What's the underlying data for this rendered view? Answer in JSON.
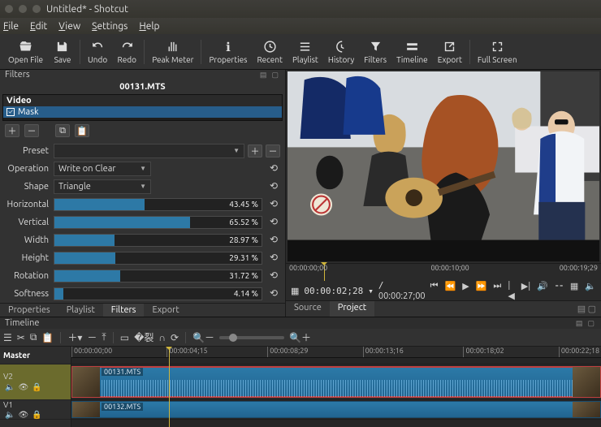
{
  "window": {
    "title": "Untitled* - Shotcut"
  },
  "menubar": [
    "File",
    "Edit",
    "View",
    "Settings",
    "Help"
  ],
  "toolbar": [
    {
      "id": "open-file",
      "label": "Open File",
      "icon": "open"
    },
    {
      "id": "save",
      "label": "Save",
      "icon": "disk"
    },
    {
      "sep": true
    },
    {
      "id": "undo",
      "label": "Undo",
      "icon": "undo"
    },
    {
      "id": "redo",
      "label": "Redo",
      "icon": "redo"
    },
    {
      "sep": true
    },
    {
      "id": "peak-meter",
      "label": "Peak Meter",
      "icon": "meter"
    },
    {
      "sep": true
    },
    {
      "id": "properties",
      "label": "Properties",
      "icon": "info"
    },
    {
      "id": "recent",
      "label": "Recent",
      "icon": "clock"
    },
    {
      "id": "playlist",
      "label": "Playlist",
      "icon": "list"
    },
    {
      "id": "history",
      "label": "History",
      "icon": "timer"
    },
    {
      "id": "filters",
      "label": "Filters",
      "icon": "funnel"
    },
    {
      "id": "timeline",
      "label": "Timeline",
      "icon": "tl"
    },
    {
      "id": "export",
      "label": "Export",
      "icon": "export"
    },
    {
      "sep": true
    },
    {
      "id": "full-screen",
      "label": "Full Screen",
      "icon": "full"
    }
  ],
  "filters_panel": {
    "title": "Filters",
    "clip_title": "00131.MTS",
    "group": "Video",
    "items": [
      {
        "name": "Mask",
        "checked": true
      }
    ],
    "preset_label": "Preset",
    "preset_value": "",
    "operation_label": "Operation",
    "operation_value": "Write on Clear",
    "shape_label": "Shape",
    "shape_value": "Triangle",
    "sliders": [
      {
        "label": "Horizontal",
        "value": "43.45 %",
        "pct": 43.45
      },
      {
        "label": "Vertical",
        "value": "65.52 %",
        "pct": 65.52
      },
      {
        "label": "Width",
        "value": "28.97 %",
        "pct": 28.97
      },
      {
        "label": "Height",
        "value": "29.31 %",
        "pct": 29.31
      },
      {
        "label": "Rotation",
        "value": "31.72 %",
        "pct": 31.72
      },
      {
        "label": "Softness",
        "value": "4.14 %",
        "pct": 4.14
      }
    ]
  },
  "left_tabs": [
    "Properties",
    "Playlist",
    "Filters",
    "Export"
  ],
  "left_tab_active": "Filters",
  "player": {
    "ruler": [
      "00:00:00;00",
      "00:00:10;00",
      "00:00:19;29"
    ],
    "current": "00:00:02;28",
    "total": "00:00:27;00",
    "frame_arrow": "▾",
    "tabs": [
      "Source",
      "Project"
    ],
    "tab_active": "Project"
  },
  "timeline": {
    "title": "Timeline",
    "ruler": [
      "00:00:00;00",
      "00:00:04;15",
      "00:00:08;29",
      "00:00:13;16",
      "00:00:18;02",
      "00:00:22;18"
    ],
    "tracks": [
      {
        "name": "Master",
        "type": "master"
      },
      {
        "name": "V2",
        "type": "video",
        "clip": "00131.MTS"
      },
      {
        "name": "V1",
        "type": "video",
        "clip": "00132.MTS"
      }
    ]
  }
}
